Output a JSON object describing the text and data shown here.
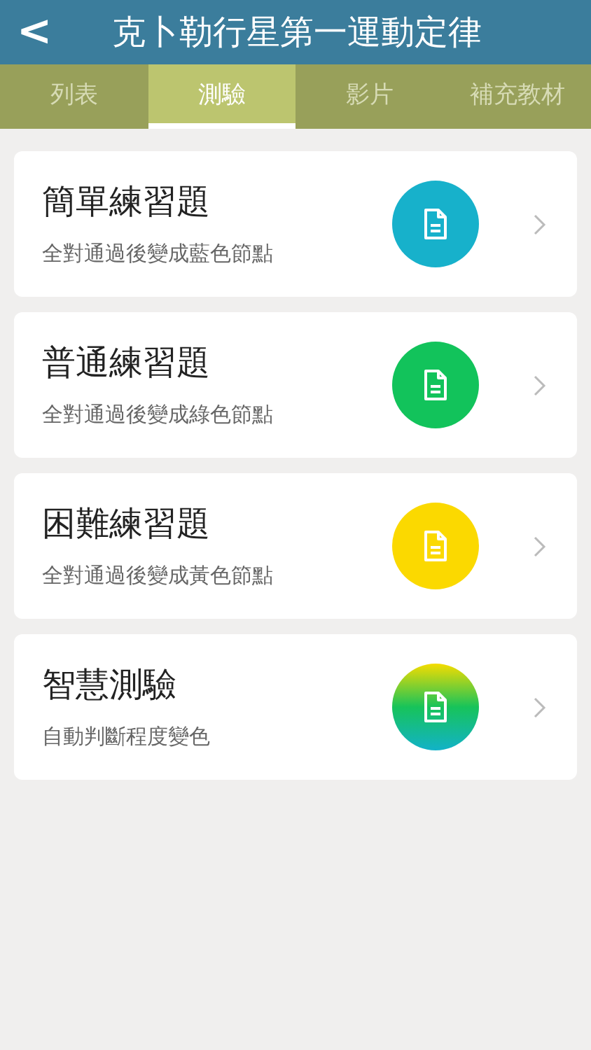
{
  "header": {
    "back": "<",
    "title": "克卜勒行星第一運動定律"
  },
  "tabs": [
    {
      "label": "列表",
      "selected": false
    },
    {
      "label": "測驗",
      "selected": true
    },
    {
      "label": "影片",
      "selected": false
    },
    {
      "label": "補充教材",
      "selected": false
    }
  ],
  "quizzes": [
    {
      "title": "簡單練習題",
      "subtitle": "全對通過後變成藍色節點",
      "kind": "solid",
      "color": "#17b1cb"
    },
    {
      "title": "普通練習題",
      "subtitle": "全對通過後變成綠色節點",
      "kind": "solid",
      "color": "#12c35b"
    },
    {
      "title": "困難練習題",
      "subtitle": "全對通過後變成黃色節點",
      "kind": "solid",
      "color": "#fbd900"
    },
    {
      "title": "智慧測驗",
      "subtitle": "自動判斷程度變色",
      "kind": "gradient"
    }
  ]
}
